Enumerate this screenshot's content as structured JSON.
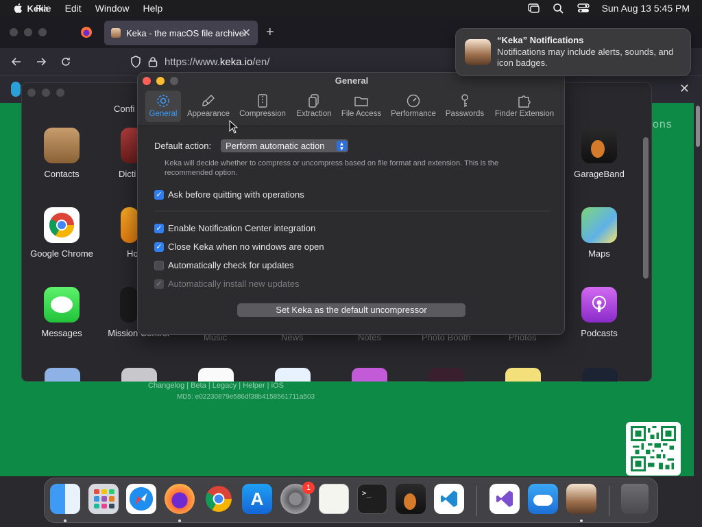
{
  "menubar": {
    "app_name": "Keka",
    "menus": [
      "File",
      "Edit",
      "Window",
      "Help"
    ],
    "clock": "Sun Aug 13  5:45 PM"
  },
  "browser": {
    "tab_title": "Keka - the macOS file archiver",
    "url_scheme": "https://www.",
    "url_host": "keka.io",
    "url_path": "/en/"
  },
  "web": {
    "options_fragment": "ons",
    "links": "Changelog | Beta | Legacy | Helper | iOS",
    "md5": "MD5: e02230879e586df38b4158561711a503"
  },
  "panel": {
    "config_label": "Confi",
    "apps": {
      "contacts": "Contacts",
      "dictionary": "Dicti",
      "garageband": "GarageBand",
      "chrome": "Google Chrome",
      "home": "Ho",
      "maps": "Maps",
      "messages": "Messages",
      "mission_control": "Mission Control",
      "music": "Music",
      "news": "News",
      "notes": "Notes",
      "photo_booth": "Photo Booth",
      "photos": "Photos",
      "podcasts": "Podcasts"
    }
  },
  "keka": {
    "title": "General",
    "tabs": [
      "General",
      "Appearance",
      "Compression",
      "Extraction",
      "File Access",
      "Performance",
      "Passwords",
      "Finder Extension"
    ],
    "default_action_label": "Default action:",
    "default_action_value": "Perform automatic action",
    "hint_line1": "Keka will decide whether to compress or uncompress based on file format and extension. This is the",
    "hint_line2": "recommended option.",
    "checkboxes": {
      "ask_quit": "Ask before quitting with operations",
      "notification": "Enable Notification Center integration",
      "close_keka": "Close Keka when no windows are open",
      "check_updates": "Automatically check for updates",
      "install_updates": "Automatically install new updates"
    },
    "default_button": "Set Keka as the default uncompressor"
  },
  "notification": {
    "title": "“Keka” Notifications",
    "body": "Notifications may include alerts, sounds, and icon badges."
  },
  "dock": {
    "settings_badge": "1"
  },
  "colors": {
    "accent": "#2f7ff2",
    "web_green": "#0c8a46",
    "active_tab_text": "#3b99fc"
  }
}
